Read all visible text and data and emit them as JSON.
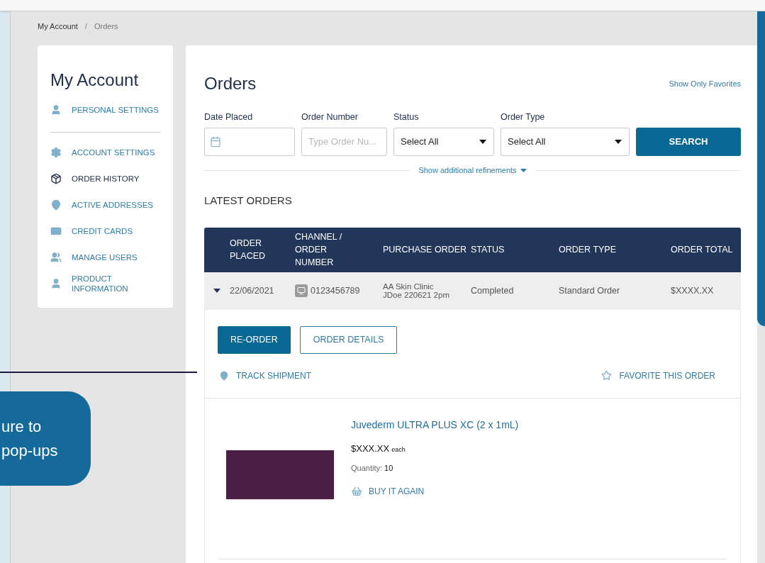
{
  "breadcrumb": {
    "separator": "/",
    "items": [
      {
        "label": "My Account",
        "current": false
      },
      {
        "label": "Orders",
        "current": true
      }
    ]
  },
  "sidebar": {
    "title": "My Account",
    "sections": [
      {
        "items": [
          {
            "label": "PERSONAL SETTINGS",
            "selected": false
          }
        ]
      },
      {
        "items": [
          {
            "label": "ACCOUNT SETTINGS",
            "selected": false
          },
          {
            "label": "ORDER HISTORY",
            "selected": true
          },
          {
            "label": "ACTIVE ADDRESSES",
            "selected": false
          },
          {
            "label": "CREDIT CARDS",
            "selected": false
          },
          {
            "label": "MANAGE USERS",
            "selected": false
          },
          {
            "label": "PRODUCT INFORMATION",
            "selected": false
          }
        ]
      }
    ]
  },
  "orders": {
    "title": "Orders",
    "favorites_link": "Show Only Favorites",
    "filters": [
      {
        "kind": "date",
        "label": "Date Placed"
      },
      {
        "kind": "text",
        "label": "Order Number",
        "placeholder": "Type Order Nu..."
      },
      {
        "kind": "select",
        "label": "Status",
        "value": "Select All"
      },
      {
        "kind": "select",
        "label": "Order Type",
        "value": "Select All"
      }
    ],
    "search_button": "SEARCH",
    "refinements_link": "Show additional refinements",
    "section_title": "LATEST ORDERS",
    "table": {
      "columns": [
        "ORDER PLACED",
        "CHANNEL / ORDER NUMBER",
        "PURCHASE ORDER",
        "STATUS",
        "ORDER TYPE",
        "ORDER TOTAL"
      ],
      "rows": [
        {
          "expanded": true,
          "order_placed": "22/06/2021",
          "order_number": "0123456789",
          "purchase_order": [
            "AA Skin Clinic",
            "JDoe 220621 2pm"
          ],
          "status": "Completed",
          "order_type": "Standard Order",
          "order_total": "$XXXX.XX",
          "detail": {
            "buttons": [
              {
                "kind": "primary",
                "label": "RE-ORDER"
              },
              {
                "kind": "secondary",
                "label": "ORDER DETAILS"
              }
            ],
            "track_link": "TRACK SHIPMENT",
            "favorite_link": "FAVORITE THIS ORDER",
            "products": [
              {
                "name": "Juvederm ULTRA PLUS XC (2 x 1mL)",
                "price": "$XXX.XX",
                "price_unit": "each",
                "quantity_label": "Quantity:",
                "quantity": "10",
                "buy_again": "BUY IT AGAIN"
              }
            ]
          }
        }
      ]
    }
  },
  "callout": {
    "text": "ure to pop-ups"
  }
}
